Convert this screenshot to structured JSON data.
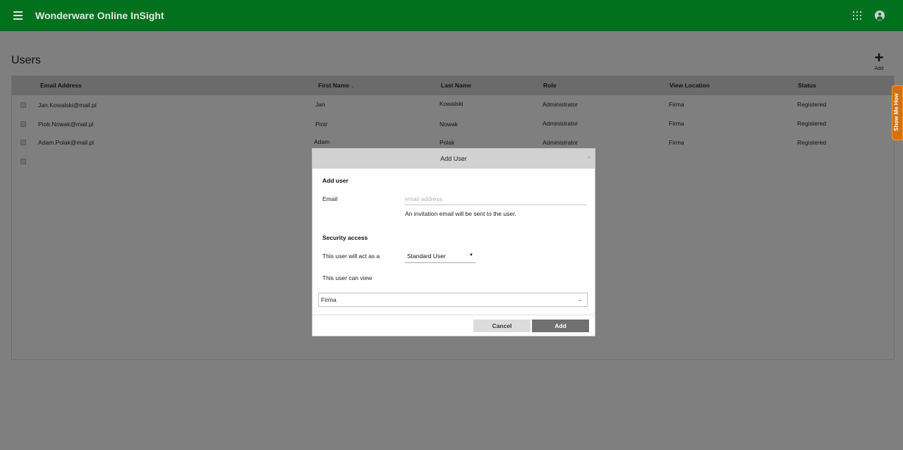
{
  "header": {
    "app_title": "Wonderware Online InSight"
  },
  "page": {
    "title": "Users",
    "add_label": "Add",
    "add_symbol": "+"
  },
  "table": {
    "columns": [
      "Email Address",
      "First Name",
      "Last Name",
      "Role",
      "View Location",
      "Status"
    ],
    "sort_indicator": "⌄",
    "rows": [
      {
        "email": "Jan.Kowalski@mail.pl",
        "first": "Jan",
        "last": "Kowalski",
        "role": "Administrator",
        "location": "Firma",
        "status": "Registered"
      },
      {
        "email": "Piotr.Nowak@mail.pl",
        "first": "Piotr",
        "last": "Nowak",
        "role": "Administrator",
        "location": "Firma",
        "status": "Registered"
      },
      {
        "email": "Adam.Polak@mail.pl",
        "first": "Adam",
        "last": "Polak",
        "role": "Administrator",
        "location": "Firma",
        "status": "Registered"
      }
    ]
  },
  "modal": {
    "title": "Add User",
    "close_symbol": "×",
    "add_user_heading": "Add user",
    "email_label": "Email",
    "email_value": "",
    "email_placeholder": "email address",
    "email_hint": "An invitation email will be sent to the user.",
    "security_heading": "Security access",
    "role_label": "This user will act as a",
    "role_value": "Standard User",
    "role_caret": "▼",
    "view_label": "This user can view",
    "location_value": "Firma",
    "location_chevron": "⌄",
    "cancel_label": "Cancel",
    "add_label": "Add"
  },
  "side_tab": {
    "label": "Show Me How"
  },
  "colors": {
    "header_bg": "#01711e",
    "overlay_bg": "#7f7f7f",
    "add_button_bg": "#707070",
    "side_tab_bg": "#d6700d"
  }
}
